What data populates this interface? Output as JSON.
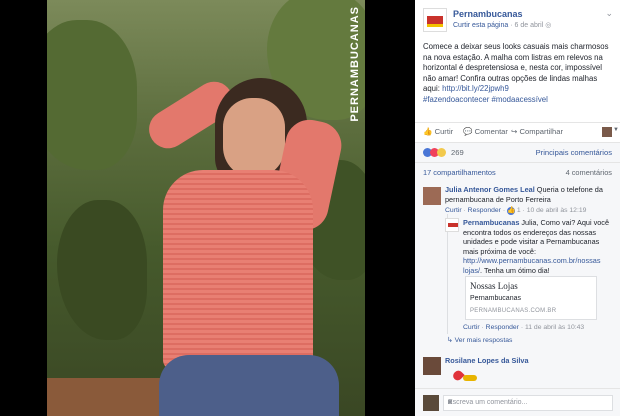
{
  "photo": {
    "brand_vertical": "PERNAMBUCANAS"
  },
  "post": {
    "page_name": "Pernambucanas",
    "like_page": "Curtir esta página",
    "date": "6 de abril",
    "text_main": "Comece a deixar seus looks casuais mais charmosos na nova estação. A malha com listras em relevos na horizontal é despretensiosa e, nesta cor, impossível não amar! Confira outras opções de lindas malhas aqui:",
    "link": "http://bit.ly/22jpwh9",
    "hashtags": "#fazendoacontecer #modaacessível"
  },
  "actions": {
    "like": "Curtir",
    "comment": "Comentar",
    "share": "Compartilhar"
  },
  "reactions": {
    "count": "269",
    "sort": "Principais comentários"
  },
  "shares": {
    "shares": "17 compartilhamentos",
    "comments": "4 comentários"
  },
  "comments": [
    {
      "name": "Julia Antenor Gomes Leal",
      "text": "Queria o telefone da pernambucana de Porto Ferreira",
      "like": "Curtir",
      "reply": "Responder",
      "likes": "1",
      "time": "10 de abril às 12:19"
    },
    {
      "name": "Pernambucanas",
      "text": "Julia, Como vai? Aqui você encontra todos os endereços das nossas unidades e pode visitar a Pernambucanas mais próxima de você:",
      "link": "http://www.pernambucanas.com.br/nossas lojas/",
      "text_end": ". Tenha um ótimo dia!",
      "card_title": "Nossas Lojas",
      "card_sub": "Pernambucanas",
      "card_url": "PERNAMBUCANAS.COM.BR",
      "like": "Curtir",
      "reply": "Responder",
      "time": "11 de abril às 10:43"
    },
    {
      "more": "Ver mais respostas"
    },
    {
      "name": "Rosilane Lopes da Silva"
    }
  ],
  "write": {
    "placeholder": "Escreva um comentário..."
  }
}
